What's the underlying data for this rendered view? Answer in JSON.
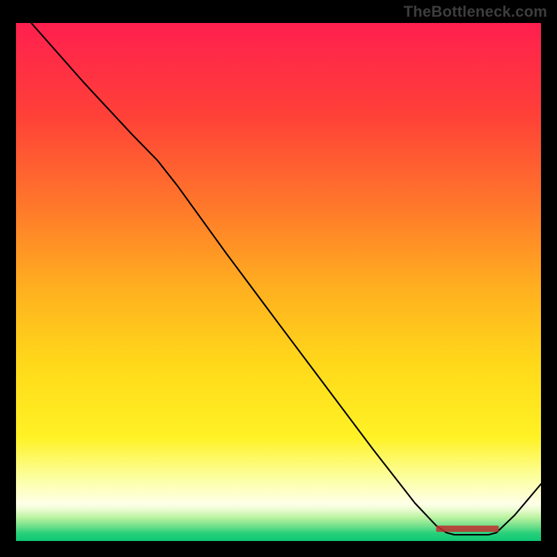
{
  "watermark": "TheBottleneck.com",
  "chart_data": {
    "type": "line",
    "title": "",
    "xlabel": "",
    "ylabel": "",
    "xlim": [
      0,
      100
    ],
    "ylim": [
      0,
      100
    ],
    "background_gradient": {
      "stops": [
        {
          "offset": 0.0,
          "color": "#ff1f4f"
        },
        {
          "offset": 0.18,
          "color": "#ff4138"
        },
        {
          "offset": 0.36,
          "color": "#ff7a2a"
        },
        {
          "offset": 0.52,
          "color": "#ffb21f"
        },
        {
          "offset": 0.66,
          "color": "#ffd91a"
        },
        {
          "offset": 0.8,
          "color": "#fff225"
        },
        {
          "offset": 0.88,
          "color": "#fcffa3"
        },
        {
          "offset": 0.928,
          "color": "#ffffe8"
        },
        {
          "offset": 0.94,
          "color": "#e9fccf"
        },
        {
          "offset": 0.955,
          "color": "#b9f2a0"
        },
        {
          "offset": 0.972,
          "color": "#6edf8a"
        },
        {
          "offset": 0.985,
          "color": "#29d07a"
        },
        {
          "offset": 1.0,
          "color": "#0dc874"
        }
      ]
    },
    "series": [
      {
        "name": "curve",
        "color": "#000000",
        "points": [
          {
            "x": 2.9,
            "y": 100.0
          },
          {
            "x": 13.0,
            "y": 88.4
          },
          {
            "x": 22.0,
            "y": 78.6
          },
          {
            "x": 27.0,
            "y": 73.4
          },
          {
            "x": 30.8,
            "y": 68.5
          },
          {
            "x": 40.0,
            "y": 55.6
          },
          {
            "x": 50.0,
            "y": 42.0
          },
          {
            "x": 60.0,
            "y": 28.5
          },
          {
            "x": 68.0,
            "y": 17.7
          },
          {
            "x": 76.0,
            "y": 7.3
          },
          {
            "x": 80.0,
            "y": 3.0
          },
          {
            "x": 82.0,
            "y": 1.6
          },
          {
            "x": 83.5,
            "y": 1.2
          },
          {
            "x": 90.0,
            "y": 1.2
          },
          {
            "x": 91.5,
            "y": 1.6
          },
          {
            "x": 95.0,
            "y": 5.0
          },
          {
            "x": 100.0,
            "y": 11.0
          }
        ]
      }
    ],
    "annotations": [
      {
        "name": "range-label",
        "text_est": "",
        "approx_x": 86.0,
        "approx_y": 2.3,
        "color": "#c12f2f"
      }
    ]
  }
}
